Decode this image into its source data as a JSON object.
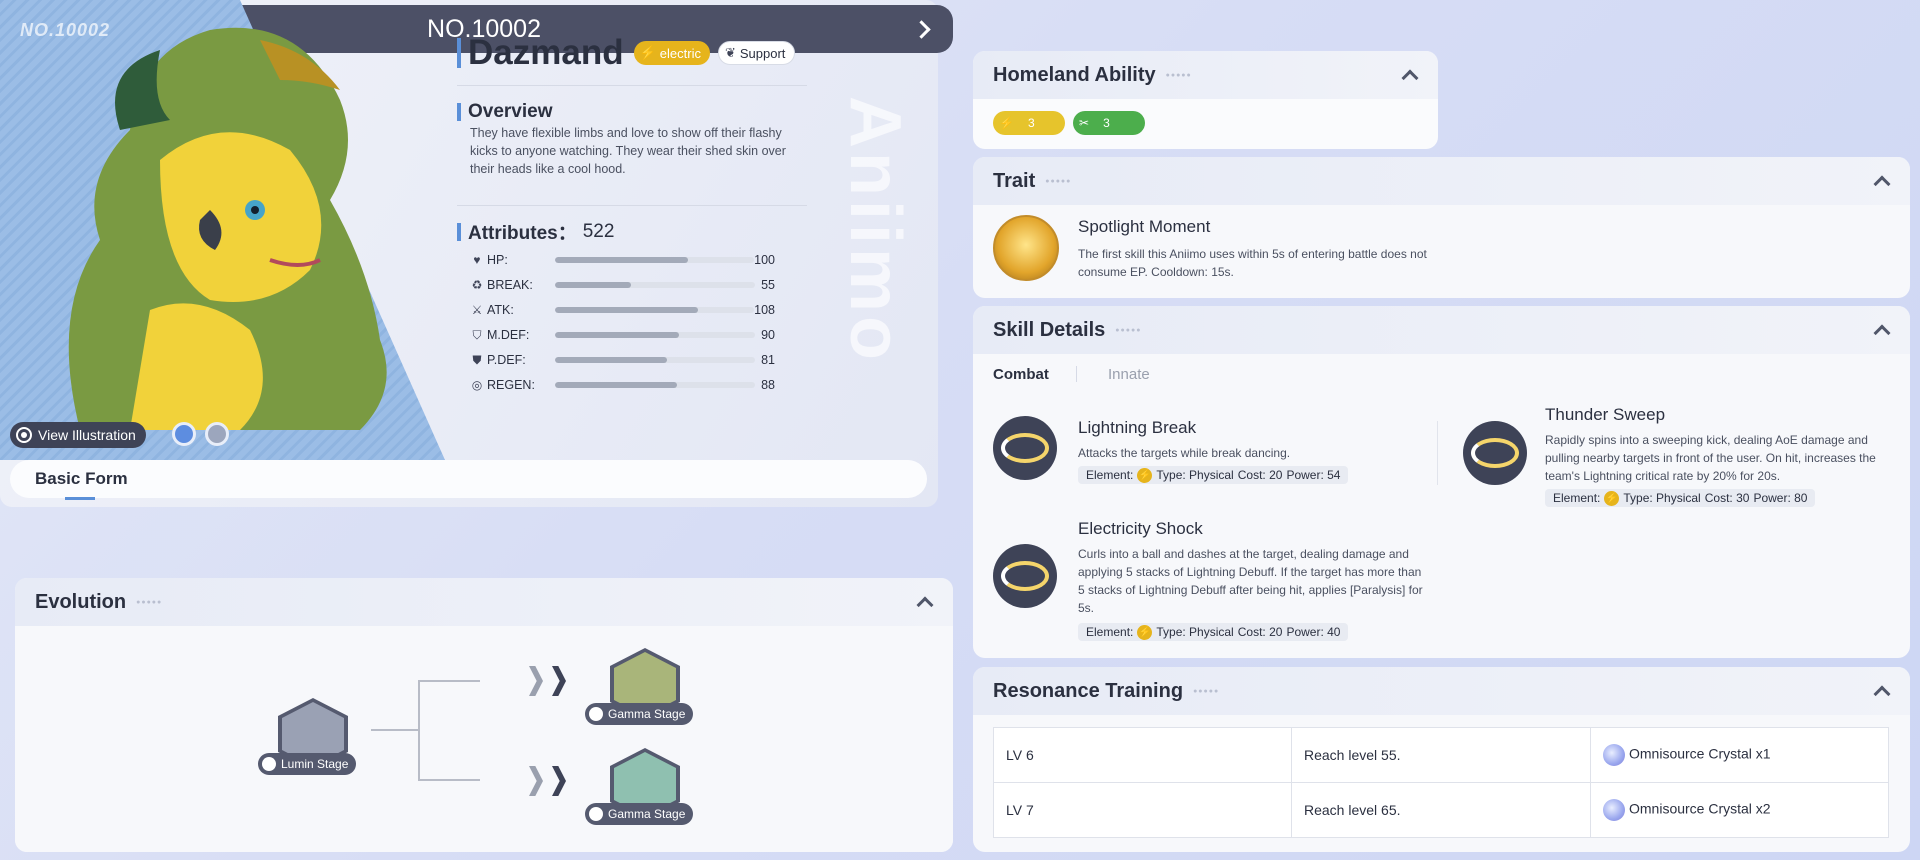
{
  "header": {
    "title": "NO.10002"
  },
  "creature": {
    "watermark": "NO.10002",
    "name": "Dazmand",
    "tags": [
      {
        "label": "electric",
        "icon": "bolt-icon",
        "color": "#e6b41c"
      },
      {
        "label": "Support",
        "icon": "leaf-icon"
      }
    ],
    "view_illustration_label": "View Illustration",
    "form_label": "Basic Form"
  },
  "overview": {
    "title": "Overview",
    "text": "They have flexible limbs and love to show off their flashy kicks to anyone watching. They wear their shed skin over their heads like a cool hood."
  },
  "attributes": {
    "label": "Attributes：",
    "total": "522",
    "stats": [
      {
        "name": "HP:",
        "value": "100",
        "icon": "heart-icon",
        "fraction": 0.67
      },
      {
        "name": "BREAK:",
        "value": "55",
        "icon": "break-icon",
        "fraction": 0.38
      },
      {
        "name": "ATK:",
        "value": "108",
        "icon": "sword-icon",
        "fraction": 0.72
      },
      {
        "name": "M.DEF:",
        "value": "90",
        "icon": "magic-shield-icon",
        "fraction": 0.62
      },
      {
        "name": "P.DEF:",
        "value": "81",
        "icon": "shield-icon",
        "fraction": 0.56
      },
      {
        "name": "REGEN:",
        "value": "88",
        "icon": "regen-icon",
        "fraction": 0.61
      }
    ]
  },
  "evolution": {
    "title": "Evolution",
    "base": {
      "label": "Lumin Stage"
    },
    "branches": [
      {
        "label": "Gamma Stage"
      },
      {
        "label": "Gamma Stage"
      }
    ]
  },
  "homeland": {
    "title": "Homeland Ability",
    "abilities": [
      {
        "icon": "bolt-icon",
        "value": "3",
        "color": "#e6c42c"
      },
      {
        "icon": "tools-icon",
        "value": "3",
        "color": "#4cae4c"
      }
    ]
  },
  "trait": {
    "title": "Trait",
    "name": "Spotlight Moment",
    "desc": "The first skill this Aniimo uses within 5s of entering battle does not consume EP. Cooldown: 15s."
  },
  "skills": {
    "title": "Skill Details",
    "tabs": [
      "Combat",
      "Innate"
    ],
    "items": [
      {
        "name": "Lightning Break",
        "desc": "Attacks the targets while break dancing.",
        "element_label": "Element:",
        "type": "Type: Physical",
        "cost": "Cost: 20",
        "power": "Power: 54"
      },
      {
        "name": "Thunder Sweep",
        "desc": "Rapidly spins into a sweeping kick, dealing AoE damage and pulling nearby targets in front of the user. On hit, increases the team's Lightning critical rate by 20% for 20s.",
        "element_label": "Element:",
        "type": "Type: Physical",
        "cost": "Cost: 30",
        "power": "Power: 80"
      },
      {
        "name": "Electricity Shock",
        "desc": "Curls into a ball and dashes at the target, dealing damage and applying 5 stacks of Lightning Debuff. If the target has more than 5 stacks of Lightning Debuff after being hit, applies [Paralysis] for 5s.",
        "element_label": "Element:",
        "type": "Type: Physical",
        "cost": "Cost: 20",
        "power": "Power: 40"
      }
    ]
  },
  "resonance": {
    "title": "Resonance Training",
    "rows": [
      {
        "level": "LV 6",
        "req": "Reach level 55.",
        "reward": "Omnisource Crystal x1"
      },
      {
        "level": "LV 7",
        "req": "Reach level 65.",
        "reward": "Omnisource Crystal x2"
      }
    ]
  }
}
